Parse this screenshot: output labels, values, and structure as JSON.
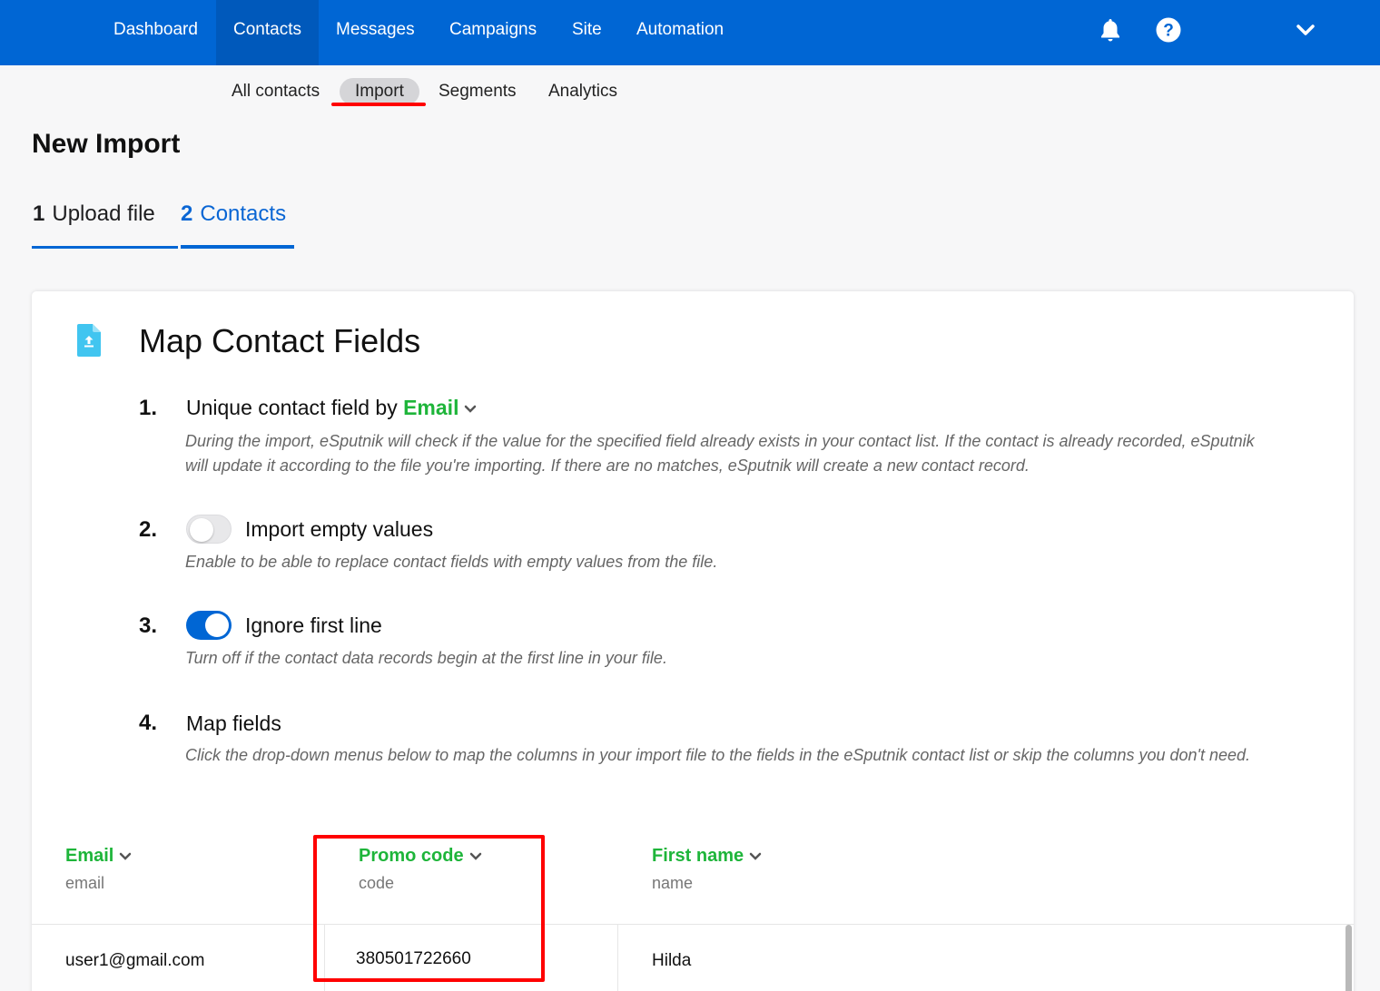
{
  "nav": {
    "items": [
      {
        "label": "Dashboard"
      },
      {
        "label": "Contacts"
      },
      {
        "label": "Messages"
      },
      {
        "label": "Campaigns"
      },
      {
        "label": "Site"
      },
      {
        "label": "Automation"
      }
    ],
    "active": "Contacts",
    "icons": [
      "bell-icon",
      "help-icon",
      "chevron-down-icon"
    ]
  },
  "subnav": {
    "items": [
      {
        "label": "All contacts"
      },
      {
        "label": "Import"
      },
      {
        "label": "Segments"
      },
      {
        "label": "Analytics"
      }
    ],
    "active": "Import"
  },
  "page": {
    "title": "New Import"
  },
  "steps": [
    {
      "num": "1",
      "label": "Upload file"
    },
    {
      "num": "2",
      "label": "Contacts"
    }
  ],
  "card": {
    "title": "Map Contact Fields",
    "icon": "file-upload-icon",
    "items": [
      {
        "num": "1.",
        "heading_prefix": "Unique contact field by",
        "heading_value": "Email",
        "description": "During the import, eSputnik will check if the value for the specified field already exists in your contact list. If the contact is already recorded, eSputnik will update it according to the file you're importing. If there are no matches, eSputnik will create a new contact record."
      },
      {
        "num": "2.",
        "heading": "Import empty values",
        "toggle": false,
        "description": "Enable to be able to replace contact fields with empty values from the file."
      },
      {
        "num": "3.",
        "heading": "Ignore first line",
        "toggle": true,
        "description": "Turn off if the contact data records begin at the first line in your file."
      },
      {
        "num": "4.",
        "heading": "Map fields",
        "description": "Click the drop-down menus below to map the columns in your import file to the fields in the eSputnik contact list or skip the columns you don't need."
      }
    ]
  },
  "mapping": {
    "columns": [
      {
        "field": "Email",
        "source": "email"
      },
      {
        "field": "Promo code",
        "source": "code"
      },
      {
        "field": "First name",
        "source": "name"
      }
    ],
    "rows": [
      [
        "user1@gmail.com",
        "380501722660",
        "Hilda"
      ]
    ]
  },
  "colors": {
    "brand": "#0066d4",
    "accent_green": "#1eb53a",
    "highlight": "#ff0000"
  }
}
